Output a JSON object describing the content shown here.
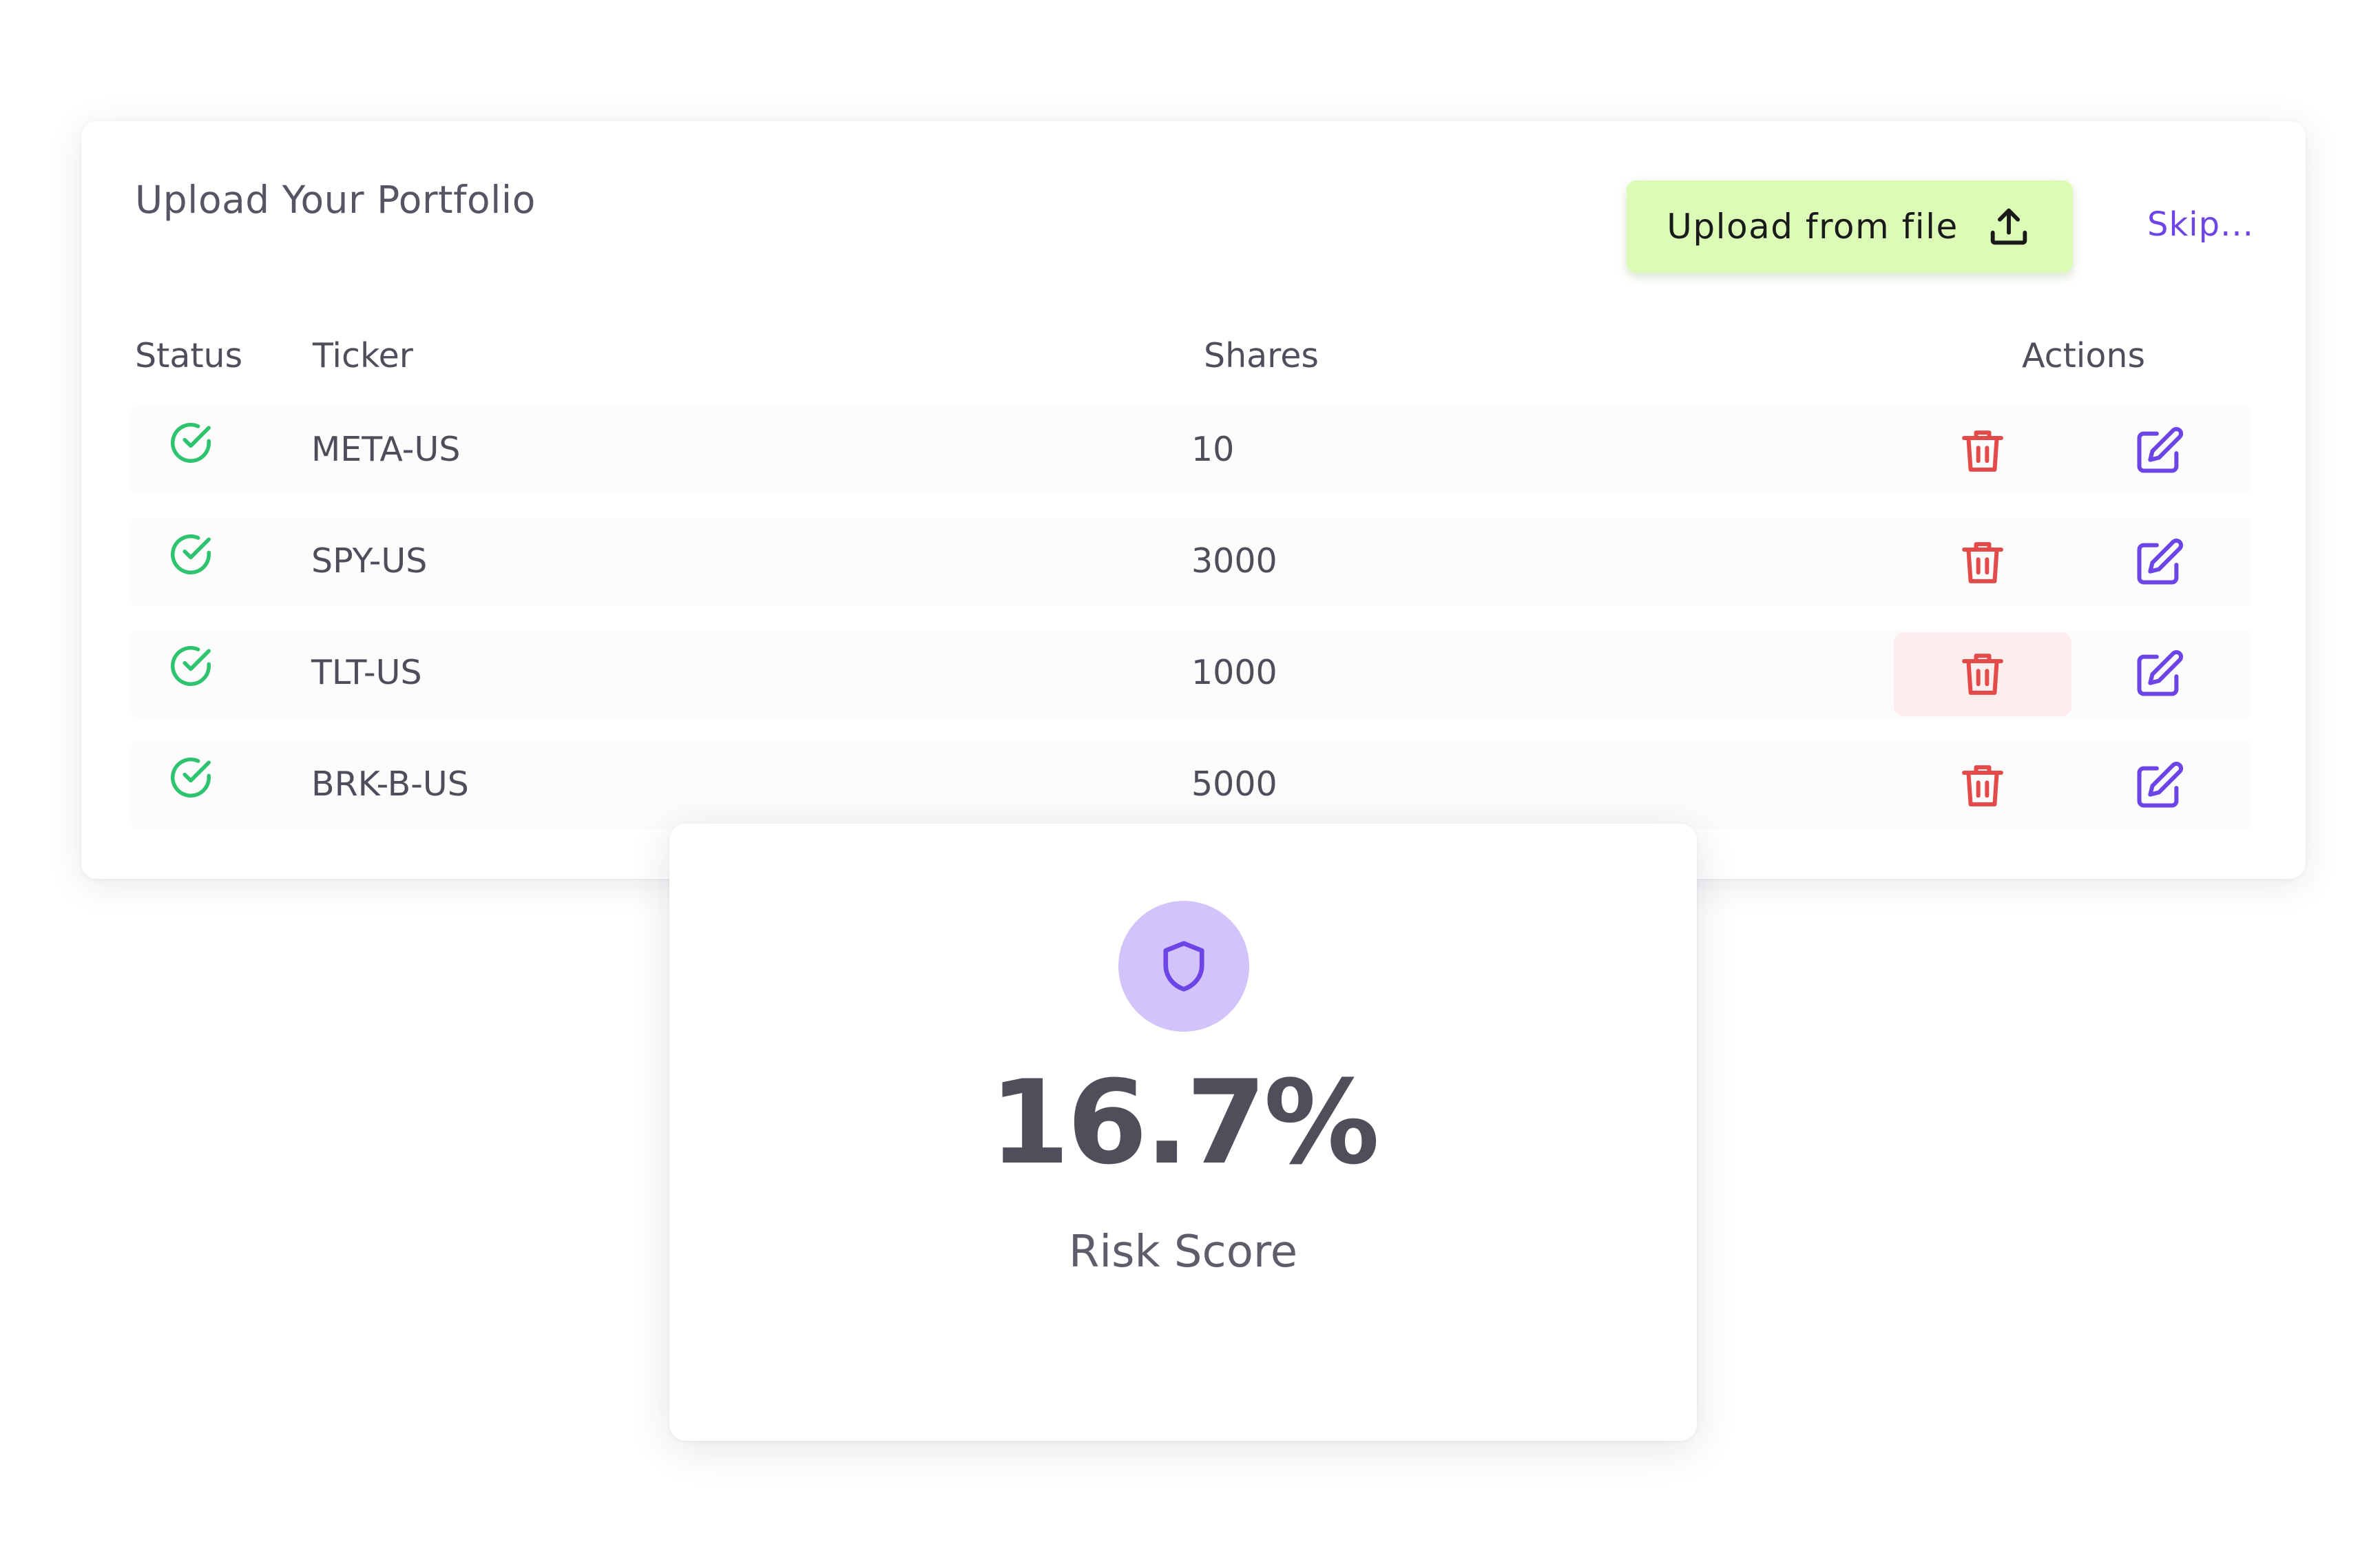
{
  "colors": {
    "status_ok": "#2ec46f",
    "delete": "#e34b4b",
    "edit": "#6d44e6",
    "upload_button_bg": "#dbfbb6",
    "skip_link": "#6d44e6",
    "shield_badge_bg": "#d2c4fa"
  },
  "portfolio": {
    "title": "Upload Your Portfolio",
    "upload_label": "Upload from file",
    "upload_icon": "upload-icon",
    "skip_label": "Skip...",
    "columns": {
      "status": "Status",
      "ticker": "Ticker",
      "shares": "Shares",
      "actions": "Actions"
    },
    "rows": [
      {
        "status_icon": "check-circle-icon",
        "ticker": "META-US",
        "shares": "10"
      },
      {
        "status_icon": "check-circle-icon",
        "ticker": "SPY-US",
        "shares": "3000"
      },
      {
        "status_icon": "check-circle-icon",
        "ticker": "TLT-US",
        "shares": "1000",
        "delete_hovered": true
      },
      {
        "status_icon": "check-circle-icon",
        "ticker": "BRK-B-US",
        "shares": "5000"
      }
    ],
    "delete_icon": "trash-icon",
    "edit_icon": "edit-icon"
  },
  "risk": {
    "icon": "shield-icon",
    "value": "16.7%",
    "label": "Risk Score"
  }
}
